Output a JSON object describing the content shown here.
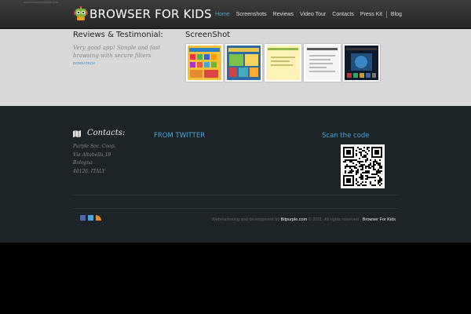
{
  "header": {
    "crumb": "www.browserforkids.com",
    "brand": "BROWSER FOR KIDS",
    "nav": [
      {
        "label": "Home",
        "active": true
      },
      {
        "label": "Screenshots"
      },
      {
        "label": "Reviews"
      },
      {
        "label": "Video Tour"
      },
      {
        "label": "Contacts"
      },
      {
        "label": "Press Kit"
      },
      {
        "label": "Blog"
      }
    ]
  },
  "reviews": {
    "title": "Reviews & Testimonial:",
    "quote": "Very good app! Simple and fast browsing with secure filters",
    "author": "DONNATECH"
  },
  "screenshots": {
    "title": "ScreenShot"
  },
  "contacts": {
    "title": "Contacts:",
    "lines": [
      "Purple Soc. Coop.",
      "Via Altabella,19",
      "Bologna",
      "40126, ITALY"
    ]
  },
  "twitter": {
    "title": "FROM TWITTER"
  },
  "qr": {
    "title": "Scan the code"
  },
  "footer": {
    "prefix": "Webmarketing and development by",
    "company": "Bitpurple.com",
    "middle": "© 2011. All rights reserved -",
    "product": "Browser For Kids"
  },
  "colors": {
    "accent": "#4aa6d8",
    "dark_bg": "#1c2427",
    "grey_bg": "#d8d8d8"
  }
}
